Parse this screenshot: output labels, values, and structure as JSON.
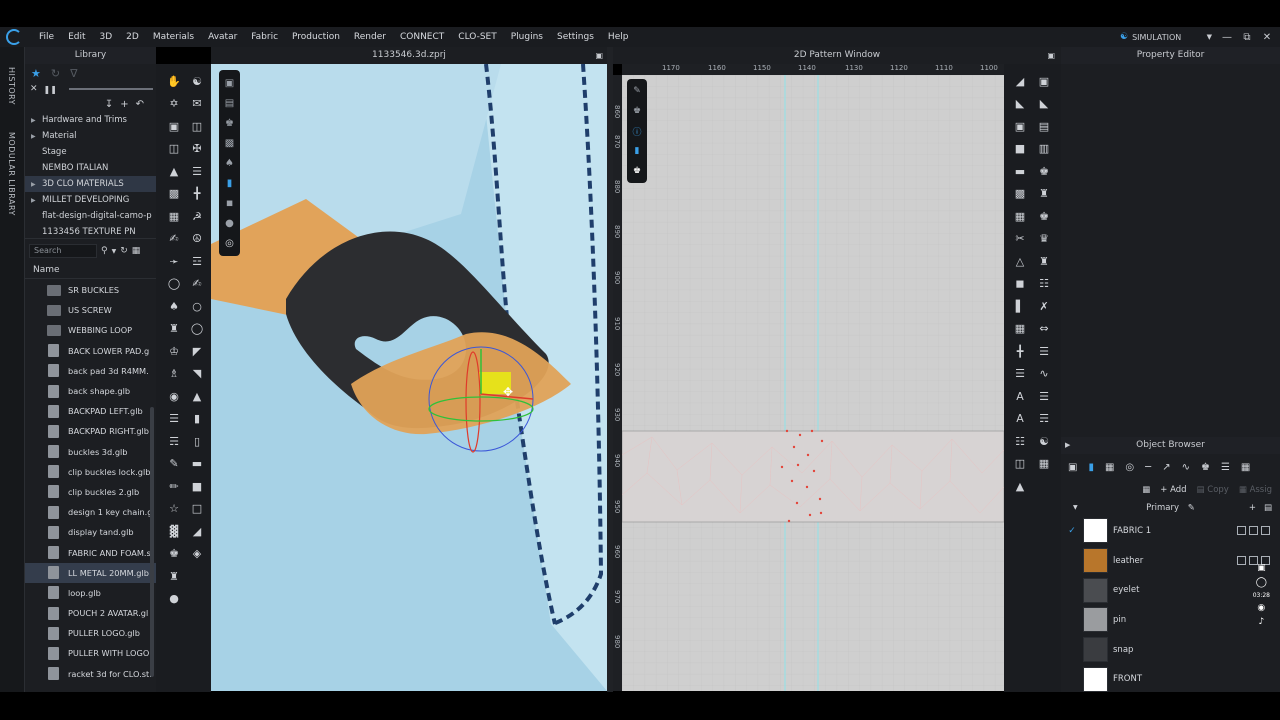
{
  "menubar": {
    "items": [
      "File",
      "Edit",
      "3D",
      "2D",
      "Materials",
      "Avatar",
      "Fabric",
      "Production",
      "Render",
      "CONNECT",
      "CLO-SET",
      "Plugins",
      "Settings",
      "Help"
    ],
    "mode": "SIMULATION"
  },
  "side_tabs": {
    "history": "HISTORY",
    "modular": "MODULAR LIBRARY"
  },
  "library": {
    "title": "Library",
    "tree": [
      {
        "label": "Hardware and Trims",
        "arrow": true,
        "selected": false
      },
      {
        "label": "Material",
        "arrow": true,
        "selected": false
      },
      {
        "label": "Stage",
        "arrow": false,
        "selected": false
      },
      {
        "label": "NEMBO ITALIAN",
        "arrow": false,
        "selected": false
      },
      {
        "label": "3D CLO MATERIALS",
        "arrow": true,
        "selected": true
      },
      {
        "label": "MILLET DEVELOPING",
        "arrow": true,
        "selected": false
      },
      {
        "label": "flat-design-digital-camo-p",
        "arrow": false,
        "selected": false
      },
      {
        "label": "1133456 TEXTURE PN",
        "arrow": false,
        "selected": false
      }
    ],
    "search_placeholder": "Search",
    "column_header": "Name",
    "files": [
      {
        "label": "SR BUCKLES",
        "kind": "folder",
        "selected": false
      },
      {
        "label": "US SCREW",
        "kind": "folder",
        "selected": false
      },
      {
        "label": "WEBBING LOOP",
        "kind": "folder",
        "selected": false
      },
      {
        "label": "BACK LOWER PAD.g",
        "kind": "file",
        "selected": false
      },
      {
        "label": "back pad 3d R4MM.",
        "kind": "file",
        "selected": false
      },
      {
        "label": "back shape.glb",
        "kind": "file",
        "selected": false
      },
      {
        "label": "BACKPAD LEFT.glb",
        "kind": "file",
        "selected": false
      },
      {
        "label": "BACKPAD RIGHT.glb",
        "kind": "file",
        "selected": false
      },
      {
        "label": "buckles 3d.glb",
        "kind": "file",
        "selected": false
      },
      {
        "label": "clip buckles lock.glb",
        "kind": "file",
        "selected": false
      },
      {
        "label": "clip buckles 2.glb",
        "kind": "file",
        "selected": false
      },
      {
        "label": "design 1 key chain.g",
        "kind": "file",
        "selected": false
      },
      {
        "label": "display tand.glb",
        "kind": "file",
        "selected": false
      },
      {
        "label": "FABRIC AND FOAM.s",
        "kind": "file",
        "selected": false
      },
      {
        "label": "LL METAL 20MM.glb",
        "kind": "file",
        "selected": true
      },
      {
        "label": "loop.glb",
        "kind": "file",
        "selected": false
      },
      {
        "label": "POUCH 2 AVATAR.gl",
        "kind": "file",
        "selected": false
      },
      {
        "label": "PULLER LOGO.glb",
        "kind": "file",
        "selected": false
      },
      {
        "label": "PULLER WITH LOGO",
        "kind": "file",
        "selected": false
      },
      {
        "label": "racket 3d for CLO.stl",
        "kind": "file",
        "selected": false
      }
    ]
  },
  "view3d": {
    "title": "1133546.3d.zprj"
  },
  "view2d": {
    "title": "2D Pattern Window",
    "ruler_x": [
      "1170",
      "1160",
      "1150",
      "1140",
      "1130",
      "1120",
      "1110",
      "1100"
    ],
    "ruler_y": [
      "860",
      "870",
      "880",
      "890",
      "900",
      "910",
      "920",
      "930",
      "940",
      "950",
      "960",
      "970",
      "980"
    ]
  },
  "property_editor": {
    "title": "Property Editor"
  },
  "object_browser": {
    "title": "Object Browser",
    "add_label": "Add",
    "copy_label": "Copy",
    "assign_label": "Assig",
    "group_label": "Primary",
    "clock": "03:28",
    "fabrics": [
      {
        "name": "FABRIC 1",
        "color": "#ffffff",
        "checked": true
      },
      {
        "name": "leather",
        "color": "#b8762b",
        "checked": false
      },
      {
        "name": "eyelet",
        "color": "#4a4c50",
        "checked": false
      },
      {
        "name": "pin",
        "color": "#9a9c9f",
        "checked": false
      },
      {
        "name": "snap",
        "color": "#3a3c40",
        "checked": false
      },
      {
        "name": "FRONT",
        "color": "#ffffff",
        "checked": false
      }
    ]
  }
}
